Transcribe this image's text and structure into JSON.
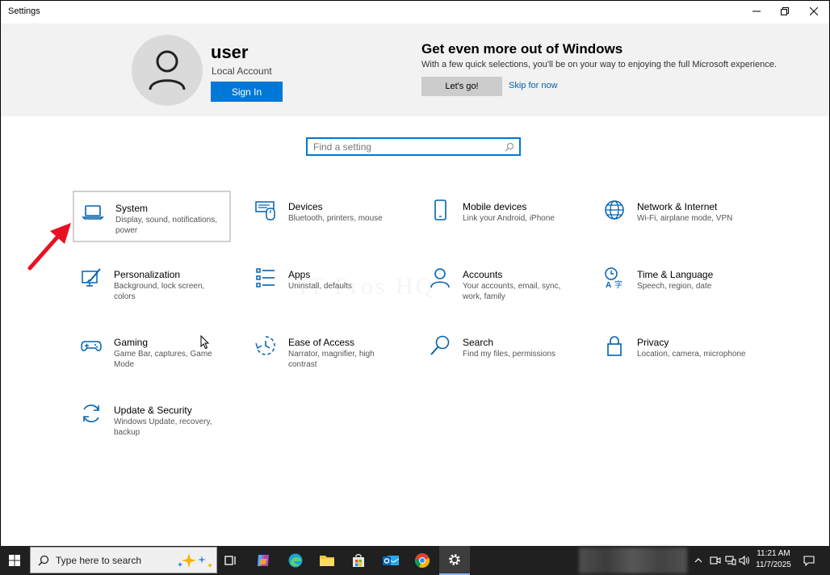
{
  "window": {
    "title": "Settings"
  },
  "header": {
    "user_name": "user",
    "account_type": "Local Account",
    "sign_in_label": "Sign In",
    "promo_title": "Get even more out of Windows",
    "promo_text": "With a few quick selections, you'll be on your way to enjoying the full Microsoft experience.",
    "lets_go_label": "Let's go!",
    "skip_label": "Skip for now"
  },
  "search": {
    "placeholder": "Find a setting"
  },
  "categories": [
    {
      "title": "System",
      "description": "Display, sound, notifications, power",
      "icon": "laptop-icon"
    },
    {
      "title": "Devices",
      "description": "Bluetooth, printers, mouse",
      "icon": "devices-icon"
    },
    {
      "title": "Mobile devices",
      "description": "Link your Android, iPhone",
      "icon": "phone-icon"
    },
    {
      "title": "Network & Internet",
      "description": "Wi-Fi, airplane mode, VPN",
      "icon": "globe-icon"
    },
    {
      "title": "Personalization",
      "description": "Background, lock screen, colors",
      "icon": "personalization-icon"
    },
    {
      "title": "Apps",
      "description": "Uninstall, defaults",
      "icon": "apps-list-icon"
    },
    {
      "title": "Accounts",
      "description": "Your accounts, email, sync, work, family",
      "icon": "person-icon"
    },
    {
      "title": "Time & Language",
      "description": "Speech, region, date",
      "icon": "time-language-icon"
    },
    {
      "title": "Gaming",
      "description": "Game Bar, captures, Game Mode",
      "icon": "gamepad-icon"
    },
    {
      "title": "Ease of Access",
      "description": "Narrator, magnifier, high contrast",
      "icon": "ease-of-access-icon"
    },
    {
      "title": "Search",
      "description": "Find my files, permissions",
      "icon": "magnifier-icon"
    },
    {
      "title": "Privacy",
      "description": "Location, camera, microphone",
      "icon": "lock-icon"
    },
    {
      "title": "Update & Security",
      "description": "Windows Update, recovery, backup",
      "icon": "sync-icon"
    }
  ],
  "taskbar": {
    "search_placeholder": "Type here to search",
    "time": "11:21 AM",
    "date": "11/7/2025"
  },
  "colors": {
    "accent": "#0078d7",
    "banner": "#f2f2f2",
    "taskbar": "#202020",
    "arrow": "#e81123"
  }
}
